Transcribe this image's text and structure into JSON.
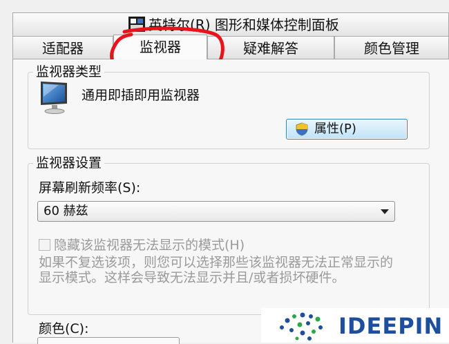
{
  "header": {
    "title": "英特尔(R) 图形和媒体控制面板",
    "icon": "intel-graphics-icon"
  },
  "tabs": [
    {
      "label": "适配器",
      "active": false
    },
    {
      "label": "监视器",
      "active": true
    },
    {
      "label": "疑难解答",
      "active": false
    },
    {
      "label": "颜色管理",
      "active": false
    }
  ],
  "monitor_type": {
    "group_title": "监视器类型",
    "monitor_name": "通用即插即用监视器",
    "icon": "monitor-icon",
    "properties_button": "属性(P)",
    "properties_icon": "uac-shield-icon"
  },
  "monitor_settings": {
    "group_title": "监视器设置",
    "refresh_label": "屏幕刷新频率(S):",
    "refresh_value": "60 赫兹",
    "hide_modes_label": "隐藏该监视器无法显示的模式(H)",
    "hide_modes_checked": false,
    "description_line1": "如果不复选该项，则您可以选择那些该监视器无法正常显示的",
    "description_line2": "显示模式。这样会导致无法显示并且/或者损坏硬件。"
  },
  "colors": {
    "label": "颜色(C):"
  },
  "watermark": {
    "text": "IDEEPIN"
  },
  "theme": {
    "highlight_circle": "#e8141c",
    "button_border": "#3c7fb1",
    "logo_blue": "#1d4f9c",
    "logo_green": "#2aa84a"
  }
}
